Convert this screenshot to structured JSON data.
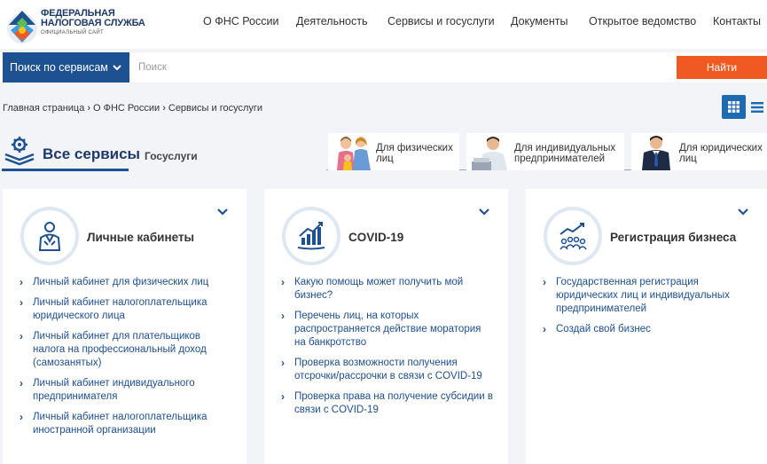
{
  "header": {
    "logo_line1": "ФЕДЕРАЛЬНАЯ",
    "logo_line2": "НАЛОГОВАЯ СЛУЖБА",
    "logo_line3": "ОФИЦИАЛЬНЫЙ САЙТ",
    "nav": [
      "О ФНС России",
      "Деятельность",
      "Сервисы и госуслуги",
      "Документы",
      "Открытое ведомство",
      "Контакты"
    ]
  },
  "search": {
    "dropdown_label": "Поиск по сервисам",
    "placeholder": "Поиск",
    "button_label": "Найти",
    "accent_color": "#f05a22"
  },
  "breadcrumb": [
    "Главная страница",
    "О ФНС России",
    "Сервисы и госуслуги"
  ],
  "view_toggle": {
    "active": "grid-icon",
    "inactive": "list-icon"
  },
  "tabs": {
    "active": "Все сервисы",
    "secondary": "Госуслуги"
  },
  "segments": [
    {
      "label_line1": "Для физических",
      "label_line2": "лиц",
      "icon": "family-icon"
    },
    {
      "label_line1": "Для индивидуальных",
      "label_line2": "предпринимателей",
      "icon": "entrepreneur-icon"
    },
    {
      "label_line1": "Для юридических",
      "label_line2": "лиц",
      "icon": "businessman-icon"
    }
  ],
  "cards": [
    {
      "title": "Личные кабинеты",
      "icon": "person-icon",
      "links": [
        "Личный кабинет для физических лиц",
        "Личный кабинет налогоплательщика юридического лица",
        "Личный кабинет для плательщиков налога на профессиональный доход (самозанятых)",
        "Личный кабинет индивидуального предпринимателя",
        "Личный кабинет налогоплательщика иностранной организации"
      ]
    },
    {
      "title": "COVID-19",
      "icon": "chart-icon",
      "links": [
        "Какую помощь может получить мой бизнес?",
        "Перечень лиц, на которых распространяется действие моратория на банкротство",
        "Проверка возможности получения отсрочки/рассрочки в связи с COVID-19",
        "Проверка права на получение субсидии в связи с COVID-19"
      ]
    },
    {
      "title": "Регистрация бизнеса",
      "icon": "group-growth-icon",
      "links": [
        "Государственная регистрация юридических лиц и индивидуальных предпринимателей",
        "Создай свой бизнес"
      ]
    }
  ],
  "colors": {
    "brand": "#1d5191",
    "link": "#1d4f91"
  }
}
